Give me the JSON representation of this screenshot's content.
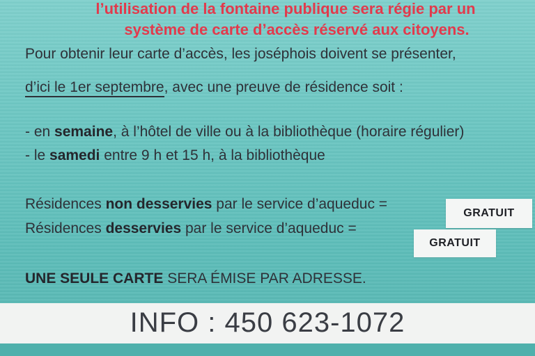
{
  "header": {
    "line1": "l’utilisation de la fontaine publique sera régie par un",
    "line2": "système de carte d’accès réservé aux citoyens."
  },
  "intro": {
    "line1": "Pour obtenir leur carte d’accès, les joséphois doivent se présenter,",
    "deadline": "d’ici le 1er septembre",
    "line2_rest": ", avec une preuve de résidence soit :"
  },
  "schedule": {
    "weekday_prefix": "- en ",
    "weekday_bold": "semaine",
    "weekday_rest": ", à l’hôtel de ville ou à la bibliothèque (horaire régulier)",
    "saturday_prefix": "- le ",
    "saturday_bold": "samedi",
    "saturday_rest": " entre 9 h et 15 h, à la bibliothèque"
  },
  "fees": {
    "row1_prefix": "Résidences ",
    "row1_bold": "non desservies",
    "row1_rest": " par le service d’aqueduc =",
    "row1_price": "GRATUIT",
    "row2_prefix": "Résidences ",
    "row2_bold": "desservies",
    "row2_rest": " par le service d’aqueduc =",
    "row2_price": "GRATUIT"
  },
  "notice": {
    "bold": "UNE SEULE CARTE",
    "rest": " SERA ÉMISE PAR ADRESSE."
  },
  "info": {
    "text": "INFO : 450 623-1072"
  },
  "colors": {
    "background": "#6cc6c2",
    "heading_red": "#e23a4c",
    "band": "#f2f3f2"
  }
}
